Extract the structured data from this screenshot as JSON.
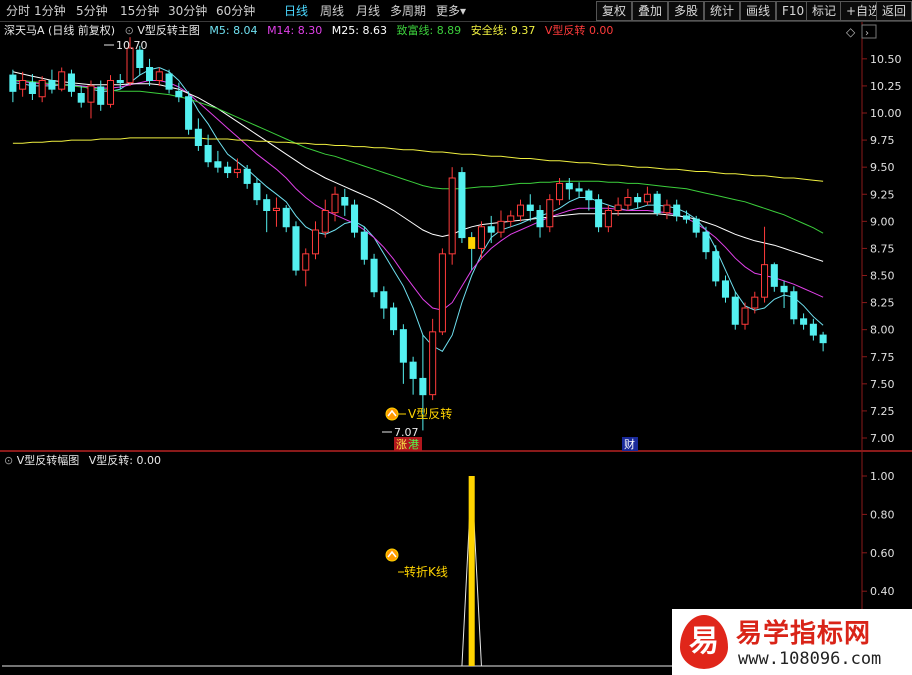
{
  "toolbar": {
    "periods": [
      "分时",
      "1分钟",
      "5分钟",
      "15分钟",
      "30分钟",
      "60分钟",
      "日线",
      "周线",
      "月线",
      "多周期",
      "更多"
    ],
    "active_period": "日线",
    "more_arrow": "▾",
    "actions": [
      "复权",
      "叠加",
      "多股",
      "统计",
      "画线",
      "F10",
      "标记",
      "+自选",
      "返回"
    ]
  },
  "main_panel": {
    "stock_title": "深天马A (日线 前复权)",
    "indicator_name": "V型反转主图",
    "legend": [
      {
        "label": "M5:",
        "value": "8.04",
        "color": "#6fe0f0"
      },
      {
        "label": "M14:",
        "value": "8.30",
        "color": "#e040e8"
      },
      {
        "label": "M25:",
        "value": "8.63",
        "color": "#ffffff"
      },
      {
        "label": "致富线:",
        "value": "8.89",
        "color": "#3ccf3c"
      },
      {
        "label": "安全线:",
        "value": "9.37",
        "color": "#f0f040"
      },
      {
        "label": "V型反转",
        "value": "0.00",
        "color": "#ff3b3b"
      }
    ],
    "price_axis": [
      "10.50",
      "10.25",
      "10.00",
      "9.75",
      "9.50",
      "9.25",
      "9.00",
      "8.75",
      "8.50",
      "8.25",
      "8.00",
      "7.75",
      "7.50",
      "7.25",
      "7.00"
    ],
    "high_label": "10.70",
    "low_label": "7.07",
    "signal_label": "V型反转",
    "event_tags": [
      "涨",
      "港",
      "财"
    ]
  },
  "sub_panel": {
    "indicator_name": "V型反转幅图",
    "legend_label": "V型反转:",
    "legend_value": "0.00",
    "axis": [
      "1.00",
      "0.80",
      "0.60",
      "0.40"
    ],
    "signal_label": "转折K线",
    "signal_value": 1.0
  },
  "watermark": {
    "badge": "易",
    "title": "易学指标网",
    "url": "www.108096.com"
  },
  "colors": {
    "up_candle": "#ff3b3b",
    "down_candle": "#54f0f0",
    "ma5": "#6fe0f0",
    "ma14": "#e040e8",
    "ma25": "#ffffff",
    "zhifu": "#3ccf3c",
    "anquan": "#f0f040",
    "signal": "#ffd400",
    "grid": "#8a1a1a"
  },
  "chart_data": {
    "type": "candlestick",
    "price_range": [
      7.0,
      10.6
    ],
    "sub_range": [
      0,
      1.0
    ],
    "signal_index": 47,
    "candles": [
      [
        10.35,
        10.2,
        10.4,
        10.1
      ],
      [
        10.22,
        10.3,
        10.38,
        10.15
      ],
      [
        10.28,
        10.18,
        10.36,
        10.12
      ],
      [
        10.15,
        10.3,
        10.34,
        10.1
      ],
      [
        10.3,
        10.22,
        10.4,
        10.18
      ],
      [
        10.22,
        10.38,
        10.42,
        10.2
      ],
      [
        10.36,
        10.2,
        10.4,
        10.15
      ],
      [
        10.18,
        10.1,
        10.25,
        10.05
      ],
      [
        10.1,
        10.25,
        10.3,
        9.95
      ],
      [
        10.24,
        10.08,
        10.3,
        10.02
      ],
      [
        10.08,
        10.3,
        10.35,
        10.05
      ],
      [
        10.3,
        10.28,
        10.36,
        10.22
      ],
      [
        10.28,
        10.6,
        10.7,
        10.25
      ],
      [
        10.58,
        10.42,
        10.62,
        10.35
      ],
      [
        10.42,
        10.3,
        10.5,
        10.25
      ],
      [
        10.3,
        10.38,
        10.42,
        10.25
      ],
      [
        10.36,
        10.22,
        10.4,
        10.18
      ],
      [
        10.2,
        10.15,
        10.28,
        10.1
      ],
      [
        10.15,
        9.85,
        10.2,
        9.8
      ],
      [
        9.85,
        9.7,
        9.95,
        9.65
      ],
      [
        9.7,
        9.55,
        9.8,
        9.5
      ],
      [
        9.55,
        9.5,
        9.65,
        9.45
      ],
      [
        9.5,
        9.45,
        9.55,
        9.4
      ],
      [
        9.45,
        9.48,
        9.58,
        9.4
      ],
      [
        9.48,
        9.35,
        9.52,
        9.3
      ],
      [
        9.35,
        9.2,
        9.4,
        9.15
      ],
      [
        9.2,
        9.1,
        9.25,
        8.9
      ],
      [
        9.1,
        9.12,
        9.22,
        8.95
      ],
      [
        9.12,
        8.95,
        9.15,
        8.9
      ],
      [
        8.95,
        8.55,
        9.0,
        8.5
      ],
      [
        8.55,
        8.7,
        8.75,
        8.4
      ],
      [
        8.7,
        8.92,
        9.0,
        8.65
      ],
      [
        8.9,
        9.1,
        9.2,
        8.85
      ],
      [
        9.08,
        9.25,
        9.32,
        9.0
      ],
      [
        9.22,
        9.15,
        9.3,
        9.05
      ],
      [
        9.15,
        8.9,
        9.2,
        8.85
      ],
      [
        8.9,
        8.65,
        8.95,
        8.6
      ],
      [
        8.65,
        8.35,
        8.7,
        8.3
      ],
      [
        8.35,
        8.2,
        8.4,
        8.1
      ],
      [
        8.2,
        8.0,
        8.25,
        7.95
      ],
      [
        8.0,
        7.7,
        8.05,
        7.5
      ],
      [
        7.7,
        7.55,
        7.75,
        7.4
      ],
      [
        7.55,
        7.4,
        7.95,
        7.07
      ],
      [
        7.4,
        7.98,
        8.1,
        7.35
      ],
      [
        7.98,
        8.7,
        8.75,
        7.95
      ],
      [
        8.7,
        9.4,
        9.5,
        8.6
      ],
      [
        9.45,
        8.85,
        9.5,
        8.8
      ],
      [
        8.85,
        8.75,
        8.9,
        8.55
      ],
      [
        8.75,
        8.95,
        9.0,
        8.65
      ],
      [
        8.95,
        8.9,
        9.05,
        8.8
      ],
      [
        8.9,
        9.0,
        9.1,
        8.85
      ],
      [
        9.0,
        9.05,
        9.1,
        8.95
      ],
      [
        9.05,
        9.15,
        9.2,
        9.0
      ],
      [
        9.15,
        9.1,
        9.25,
        9.0
      ],
      [
        9.1,
        8.95,
        9.15,
        8.85
      ],
      [
        8.95,
        9.2,
        9.25,
        8.9
      ],
      [
        9.2,
        9.35,
        9.4,
        9.15
      ],
      [
        9.35,
        9.3,
        9.4,
        9.2
      ],
      [
        9.3,
        9.28,
        9.36,
        9.22
      ],
      [
        9.28,
        9.2,
        9.3,
        9.1
      ],
      [
        9.2,
        8.95,
        9.25,
        8.9
      ],
      [
        8.95,
        9.1,
        9.15,
        8.9
      ],
      [
        9.1,
        9.15,
        9.22,
        9.05
      ],
      [
        9.15,
        9.22,
        9.3,
        9.1
      ],
      [
        9.22,
        9.18,
        9.26,
        9.12
      ],
      [
        9.18,
        9.25,
        9.32,
        9.15
      ],
      [
        9.25,
        9.08,
        9.28,
        9.05
      ],
      [
        9.08,
        9.15,
        9.2,
        9.02
      ],
      [
        9.15,
        9.05,
        9.2,
        9.0
      ],
      [
        9.05,
        9.02,
        9.1,
        8.98
      ],
      [
        9.02,
        8.9,
        9.05,
        8.85
      ],
      [
        8.9,
        8.72,
        8.95,
        8.65
      ],
      [
        8.72,
        8.45,
        8.78,
        8.4
      ],
      [
        8.45,
        8.3,
        8.5,
        8.25
      ],
      [
        8.3,
        8.05,
        8.35,
        8.0
      ],
      [
        8.05,
        8.2,
        8.25,
        8.0
      ],
      [
        8.2,
        8.3,
        8.35,
        8.15
      ],
      [
        8.3,
        8.6,
        8.95,
        8.25
      ],
      [
        8.6,
        8.4,
        8.62,
        8.35
      ],
      [
        8.4,
        8.35,
        8.45,
        8.2
      ],
      [
        8.35,
        8.1,
        8.4,
        8.05
      ],
      [
        8.1,
        8.05,
        8.15,
        8.0
      ],
      [
        8.05,
        7.95,
        8.1,
        7.9
      ],
      [
        7.95,
        7.88,
        7.98,
        7.8
      ]
    ],
    "series": [
      {
        "name": "M5",
        "values": [
          10.28,
          10.27,
          10.25,
          10.25,
          10.25,
          10.26,
          10.26,
          10.25,
          10.22,
          10.2,
          10.2,
          10.22,
          10.28,
          10.35,
          10.4,
          10.42,
          10.38,
          10.3,
          10.18,
          10.02,
          9.9,
          9.75,
          9.62,
          9.55,
          9.48,
          9.4,
          9.32,
          9.25,
          9.18,
          9.05,
          8.95,
          8.9,
          8.88,
          8.92,
          8.98,
          9.0,
          8.95,
          8.85,
          8.7,
          8.55,
          8.4,
          8.2,
          7.95,
          7.85,
          7.8,
          7.95,
          8.25,
          8.5,
          8.7,
          8.85,
          8.92,
          8.95,
          8.98,
          9.02,
          9.05,
          9.08,
          9.12,
          9.18,
          9.22,
          9.22,
          9.18,
          9.15,
          9.12,
          9.1,
          9.12,
          9.15,
          9.15,
          9.14,
          9.12,
          9.08,
          9.02,
          8.92,
          8.75,
          8.55,
          8.35,
          8.22,
          8.18,
          8.2,
          8.28,
          8.32,
          8.3,
          8.22,
          8.12,
          8.04
        ]
      },
      {
        "name": "M14",
        "values": [
          10.3,
          10.29,
          10.28,
          10.27,
          10.26,
          10.26,
          10.25,
          10.25,
          10.24,
          10.23,
          10.23,
          10.24,
          10.26,
          10.28,
          10.3,
          10.3,
          10.28,
          10.24,
          10.18,
          10.1,
          10.02,
          9.94,
          9.86,
          9.78,
          9.7,
          9.62,
          9.55,
          9.48,
          9.4,
          9.3,
          9.22,
          9.15,
          9.1,
          9.06,
          9.02,
          8.98,
          8.92,
          8.85,
          8.76,
          8.65,
          8.52,
          8.4,
          8.28,
          8.2,
          8.18,
          8.25,
          8.4,
          8.55,
          8.66,
          8.75,
          8.82,
          8.88,
          8.92,
          8.96,
          9.0,
          9.04,
          9.07,
          9.1,
          9.12,
          9.12,
          9.12,
          9.12,
          9.11,
          9.1,
          9.1,
          9.1,
          9.09,
          9.08,
          9.06,
          9.03,
          8.98,
          8.92,
          8.85,
          8.76,
          8.66,
          8.58,
          8.52,
          8.5,
          8.48,
          8.45,
          8.42,
          8.38,
          8.34,
          8.3
        ]
      },
      {
        "name": "M25",
        "values": [
          10.38,
          10.36,
          10.34,
          10.32,
          10.3,
          10.29,
          10.28,
          10.27,
          10.26,
          10.26,
          10.26,
          10.26,
          10.27,
          10.27,
          10.27,
          10.26,
          10.24,
          10.22,
          10.18,
          10.14,
          10.09,
          10.04,
          9.98,
          9.92,
          9.86,
          9.8,
          9.74,
          9.68,
          9.62,
          9.56,
          9.5,
          9.45,
          9.4,
          9.36,
          9.32,
          9.28,
          9.24,
          9.2,
          9.15,
          9.1,
          9.04,
          8.98,
          8.92,
          8.88,
          8.86,
          8.88,
          8.92,
          8.95,
          8.97,
          8.98,
          8.99,
          9.0,
          9.01,
          9.02,
          9.03,
          9.04,
          9.05,
          9.06,
          9.07,
          9.07,
          9.07,
          9.07,
          9.07,
          9.07,
          9.07,
          9.07,
          9.07,
          9.06,
          9.05,
          9.04,
          9.02,
          8.99,
          8.96,
          8.92,
          8.88,
          8.85,
          8.82,
          8.8,
          8.78,
          8.75,
          8.72,
          8.69,
          8.66,
          8.63
        ]
      },
      {
        "name": "致富线",
        "values": [
          10.3,
          10.3,
          10.29,
          10.28,
          10.27,
          10.26,
          10.25,
          10.24,
          10.23,
          10.22,
          10.21,
          10.2,
          10.2,
          10.2,
          10.19,
          10.18,
          10.17,
          10.15,
          10.13,
          10.1,
          10.07,
          10.04,
          10.0,
          9.96,
          9.92,
          9.88,
          9.84,
          9.8,
          9.76,
          9.72,
          9.68,
          9.65,
          9.62,
          9.6,
          9.57,
          9.54,
          9.51,
          9.48,
          9.45,
          9.42,
          9.39,
          9.36,
          9.33,
          9.31,
          9.3,
          9.3,
          9.3,
          9.31,
          9.32,
          9.32,
          9.33,
          9.34,
          9.35,
          9.35,
          9.36,
          9.36,
          9.37,
          9.37,
          9.37,
          9.37,
          9.37,
          9.36,
          9.36,
          9.35,
          9.35,
          9.34,
          9.33,
          9.32,
          9.31,
          9.3,
          9.28,
          9.26,
          9.24,
          9.22,
          9.2,
          9.18,
          9.15,
          9.12,
          9.09,
          9.06,
          9.02,
          8.98,
          8.94,
          8.89
        ]
      },
      {
        "name": "安全线",
        "values": [
          9.72,
          9.72,
          9.73,
          9.73,
          9.74,
          9.74,
          9.75,
          9.75,
          9.75,
          9.76,
          9.76,
          9.76,
          9.77,
          9.77,
          9.77,
          9.77,
          9.77,
          9.77,
          9.77,
          9.77,
          9.76,
          9.76,
          9.76,
          9.75,
          9.75,
          9.74,
          9.74,
          9.73,
          9.73,
          9.72,
          9.72,
          9.71,
          9.71,
          9.7,
          9.7,
          9.69,
          9.69,
          9.68,
          9.68,
          9.67,
          9.66,
          9.66,
          9.65,
          9.64,
          9.64,
          9.63,
          9.62,
          9.62,
          9.61,
          9.6,
          9.6,
          9.59,
          9.58,
          9.58,
          9.57,
          9.56,
          9.56,
          9.55,
          9.54,
          9.54,
          9.53,
          9.52,
          9.52,
          9.51,
          9.5,
          9.5,
          9.49,
          9.48,
          9.48,
          9.47,
          9.46,
          9.46,
          9.45,
          9.44,
          9.44,
          9.43,
          9.42,
          9.42,
          9.41,
          9.4,
          9.4,
          9.39,
          9.38,
          9.37
        ]
      }
    ]
  }
}
